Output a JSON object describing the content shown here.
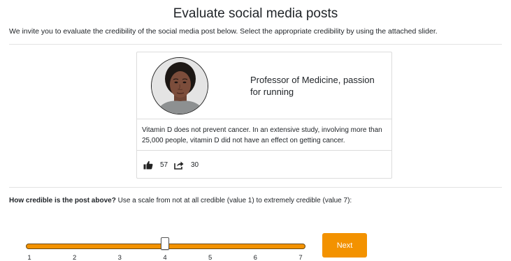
{
  "page": {
    "title": "Evaluate social media posts",
    "intro": "We invite you to evaluate the credibility of the social media post below. Select the appropriate credibility by using the attached slider."
  },
  "post": {
    "author_bio": "Professor of Medicine, passion for running",
    "text": "Vitamin D does not prevent cancer. In an extensive study, involving more than 25,000 people, vitamin D did not have an effect on getting cancer.",
    "likes": "57",
    "shares": "30",
    "like_icon": "thumbs-up-icon",
    "share_icon": "share-icon"
  },
  "question": {
    "bold": "How credible is the post above?",
    "rest": " Use a scale from not at all credible (value 1) to extremely credible (value 7):"
  },
  "slider": {
    "min": 1,
    "max": 7,
    "value": 4,
    "ticks": [
      "1",
      "2",
      "3",
      "4",
      "5",
      "6",
      "7"
    ],
    "color": "#f39200"
  },
  "next_button": {
    "label": "Next",
    "color": "#f39200"
  }
}
